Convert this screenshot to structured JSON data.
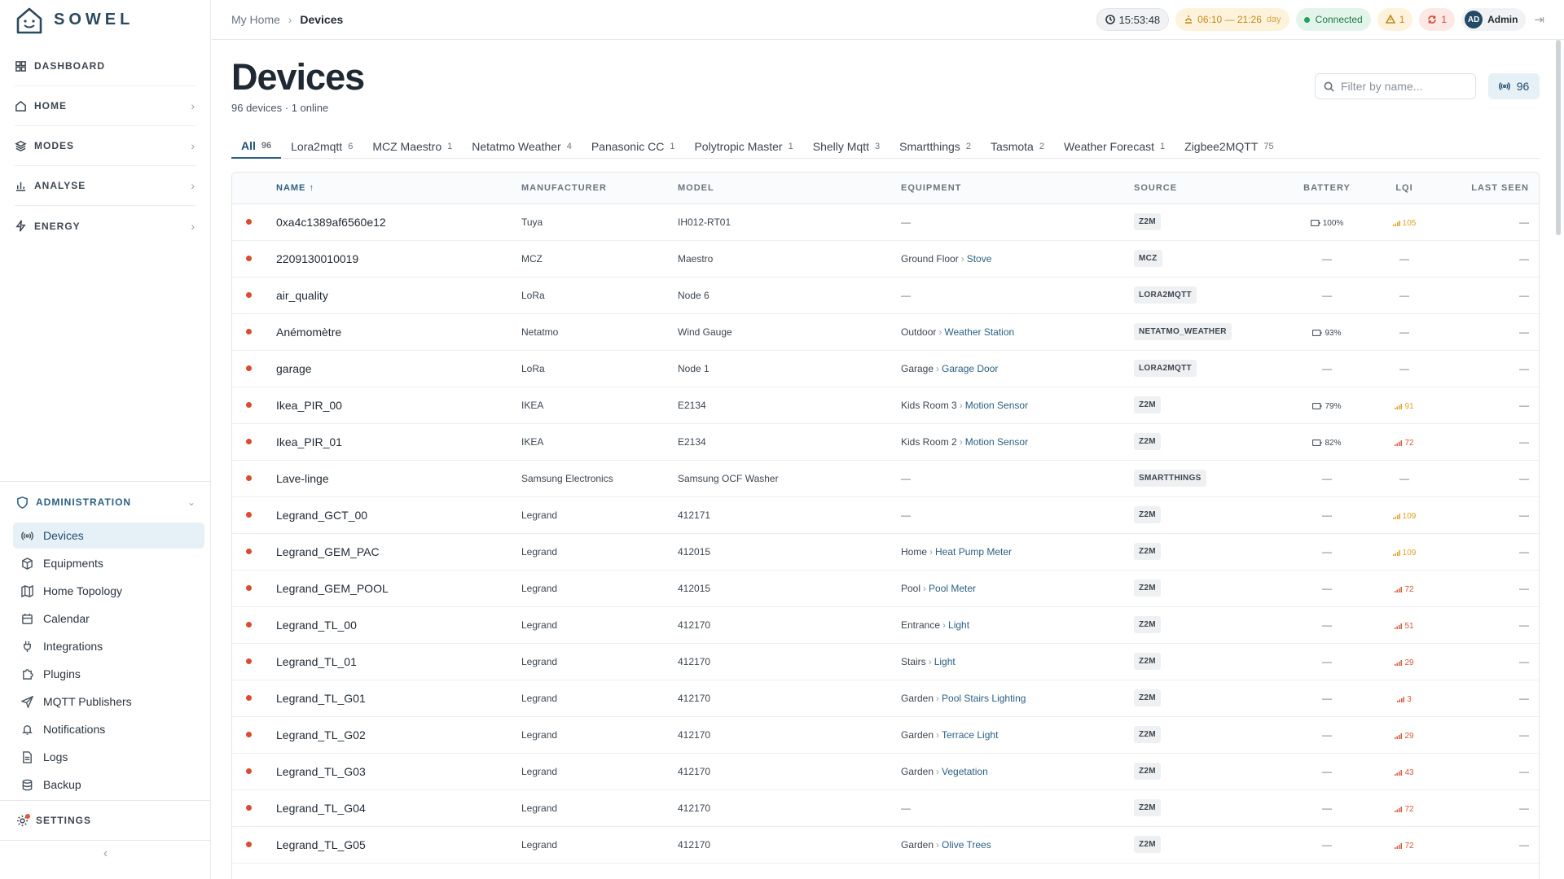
{
  "app": {
    "logo_text": "SOWEL"
  },
  "sidebar": {
    "nav": [
      {
        "label": "DASHBOARD",
        "icon": "grid-icon"
      },
      {
        "label": "HOME",
        "icon": "home-icon"
      },
      {
        "label": "MODES",
        "icon": "layers-icon"
      },
      {
        "label": "ANALYSE",
        "icon": "bar-chart-icon"
      },
      {
        "label": "ENERGY",
        "icon": "zap-icon"
      }
    ],
    "admin": {
      "label": "ADMINISTRATION",
      "items": [
        {
          "label": "Devices",
          "icon": "radio-icon"
        },
        {
          "label": "Equipments",
          "icon": "box-icon"
        },
        {
          "label": "Home Topology",
          "icon": "map-icon"
        },
        {
          "label": "Calendar",
          "icon": "calendar-icon"
        },
        {
          "label": "Integrations",
          "icon": "plug-icon"
        },
        {
          "label": "Plugins",
          "icon": "puzzle-icon"
        },
        {
          "label": "MQTT Publishers",
          "icon": "send-icon"
        },
        {
          "label": "Notifications",
          "icon": "bell-icon"
        },
        {
          "label": "Logs",
          "icon": "file-text-icon"
        },
        {
          "label": "Backup",
          "icon": "database-icon"
        }
      ]
    },
    "settings_label": "SETTINGS",
    "collapse_icon": "‹"
  },
  "topbar": {
    "breadcrumb": [
      "My Home",
      "Devices"
    ],
    "clock": "15:53:48",
    "sun_range": "06:10 — 21:26",
    "sun_label": "day",
    "connection": "Connected",
    "warnings": "1",
    "errors": "1",
    "user_initials": "AD",
    "user_name": "Admin"
  },
  "page": {
    "title": "Devices",
    "subtitle": "96 devices · 1 online",
    "filter_placeholder": "Filter by name...",
    "count": "96"
  },
  "tabs": [
    {
      "label": "All",
      "count": "96"
    },
    {
      "label": "Lora2mqtt",
      "count": "6"
    },
    {
      "label": "MCZ Maestro",
      "count": "1"
    },
    {
      "label": "Netatmo Weather",
      "count": "4"
    },
    {
      "label": "Panasonic CC",
      "count": "1"
    },
    {
      "label": "Polytropic Master",
      "count": "1"
    },
    {
      "label": "Shelly Mqtt",
      "count": "3"
    },
    {
      "label": "Smartthings",
      "count": "2"
    },
    {
      "label": "Tasmota",
      "count": "2"
    },
    {
      "label": "Weather Forecast",
      "count": "1"
    },
    {
      "label": "Zigbee2MQTT",
      "count": "75"
    }
  ],
  "table": {
    "columns": [
      "NAME ↑",
      "MANUFACTURER",
      "MODEL",
      "EQUIPMENT",
      "SOURCE",
      "BATTERY",
      "LQI",
      "LAST SEEN"
    ],
    "rows": [
      {
        "name": "0xa4c1389af6560e12",
        "manufacturer": "Tuya",
        "model": "IH012-RT01",
        "eq_loc": "",
        "eq_name": "",
        "source": "Z2M",
        "battery": "100%",
        "lqi": "105",
        "lqi_level": "good",
        "last_seen": "—"
      },
      {
        "name": "2209130010019",
        "manufacturer": "MCZ",
        "model": "Maestro",
        "eq_loc": "Ground Floor",
        "eq_name": "Stove",
        "source": "MCZ",
        "battery": "",
        "lqi": "",
        "lqi_level": "",
        "last_seen": "—"
      },
      {
        "name": "air_quality",
        "manufacturer": "LoRa",
        "model": "Node 6",
        "eq_loc": "",
        "eq_name": "",
        "source": "LORA2MQTT",
        "battery": "",
        "lqi": "",
        "lqi_level": "",
        "last_seen": "—"
      },
      {
        "name": "Anémomètre",
        "manufacturer": "Netatmo",
        "model": "Wind Gauge",
        "eq_loc": "Outdoor",
        "eq_name": "Weather Station",
        "source": "NETATMO_WEATHER",
        "battery": "93%",
        "lqi": "",
        "lqi_level": "",
        "last_seen": "—"
      },
      {
        "name": "garage",
        "manufacturer": "LoRa",
        "model": "Node 1",
        "eq_loc": "Garage",
        "eq_name": "Garage Door",
        "source": "LORA2MQTT",
        "battery": "",
        "lqi": "",
        "lqi_level": "",
        "last_seen": "—"
      },
      {
        "name": "Ikea_PIR_00",
        "manufacturer": "IKEA",
        "model": "E2134",
        "eq_loc": "Kids Room 3",
        "eq_name": "Motion Sensor",
        "source": "Z2M",
        "battery": "79%",
        "lqi": "91",
        "lqi_level": "good",
        "last_seen": "—"
      },
      {
        "name": "Ikea_PIR_01",
        "manufacturer": "IKEA",
        "model": "E2134",
        "eq_loc": "Kids Room 2",
        "eq_name": "Motion Sensor",
        "source": "Z2M",
        "battery": "82%",
        "lqi": "72",
        "lqi_level": "bad",
        "last_seen": "—"
      },
      {
        "name": "Lave-linge",
        "manufacturer": "Samsung Electronics",
        "model": "Samsung OCF Washer",
        "eq_loc": "",
        "eq_name": "",
        "source": "SMARTTHINGS",
        "battery": "",
        "lqi": "",
        "lqi_level": "",
        "last_seen": "—"
      },
      {
        "name": "Legrand_GCT_00",
        "manufacturer": "Legrand",
        "model": "412171",
        "eq_loc": "",
        "eq_name": "",
        "source": "Z2M",
        "battery": "",
        "lqi": "109",
        "lqi_level": "good",
        "last_seen": "—"
      },
      {
        "name": "Legrand_GEM_PAC",
        "manufacturer": "Legrand",
        "model": "412015",
        "eq_loc": "Home",
        "eq_name": "Heat Pump Meter",
        "source": "Z2M",
        "battery": "",
        "lqi": "109",
        "lqi_level": "good",
        "last_seen": "—"
      },
      {
        "name": "Legrand_GEM_POOL",
        "manufacturer": "Legrand",
        "model": "412015",
        "eq_loc": "Pool",
        "eq_name": "Pool Meter",
        "source": "Z2M",
        "battery": "",
        "lqi": "72",
        "lqi_level": "bad",
        "last_seen": "—"
      },
      {
        "name": "Legrand_TL_00",
        "manufacturer": "Legrand",
        "model": "412170",
        "eq_loc": "Entrance",
        "eq_name": "Light",
        "source": "Z2M",
        "battery": "",
        "lqi": "51",
        "lqi_level": "bad",
        "last_seen": "—"
      },
      {
        "name": "Legrand_TL_01",
        "manufacturer": "Legrand",
        "model": "412170",
        "eq_loc": "Stairs",
        "eq_name": "Light",
        "source": "Z2M",
        "battery": "",
        "lqi": "29",
        "lqi_level": "bad",
        "last_seen": "—"
      },
      {
        "name": "Legrand_TL_G01",
        "manufacturer": "Legrand",
        "model": "412170",
        "eq_loc": "Garden",
        "eq_name": "Pool Stairs Lighting",
        "source": "Z2M",
        "battery": "",
        "lqi": "3",
        "lqi_level": "bad",
        "last_seen": "—"
      },
      {
        "name": "Legrand_TL_G02",
        "manufacturer": "Legrand",
        "model": "412170",
        "eq_loc": "Garden",
        "eq_name": "Terrace Light",
        "source": "Z2M",
        "battery": "",
        "lqi": "29",
        "lqi_level": "bad",
        "last_seen": "—"
      },
      {
        "name": "Legrand_TL_G03",
        "manufacturer": "Legrand",
        "model": "412170",
        "eq_loc": "Garden",
        "eq_name": "Vegetation",
        "source": "Z2M",
        "battery": "",
        "lqi": "43",
        "lqi_level": "bad",
        "last_seen": "—"
      },
      {
        "name": "Legrand_TL_G04",
        "manufacturer": "Legrand",
        "model": "412170",
        "eq_loc": "",
        "eq_name": "",
        "source": "Z2M",
        "battery": "",
        "lqi": "72",
        "lqi_level": "bad",
        "last_seen": "—"
      },
      {
        "name": "Legrand_TL_G05",
        "manufacturer": "Legrand",
        "model": "412170",
        "eq_loc": "Garden",
        "eq_name": "Olive Trees",
        "source": "Z2M",
        "battery": "",
        "lqi": "72",
        "lqi_level": "bad",
        "last_seen": "—"
      }
    ],
    "empty": "—"
  },
  "colors": {
    "accent": "#2b5f82",
    "offline_dot": "#dc4a30",
    "online": "#22a35a",
    "warning": "#c28a16",
    "error": "#d24b33"
  }
}
